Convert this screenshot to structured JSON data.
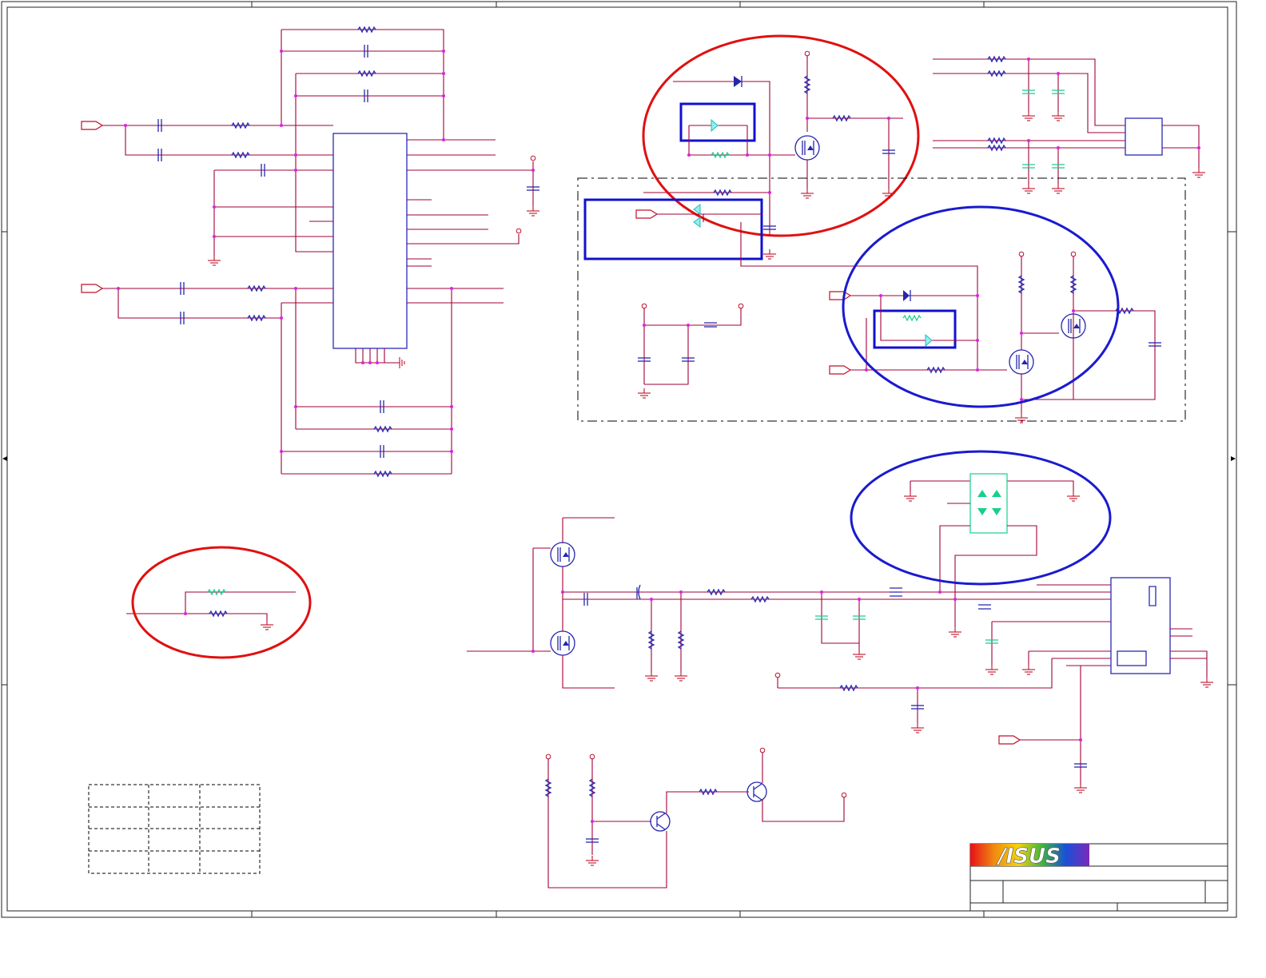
{
  "title_block": {
    "logo_text": "/ISUS",
    "logo_colors": [
      "#e8101a",
      "#f08a10",
      "#f5d20a",
      "#3fb83a",
      "#1a50d8",
      "#7a2ab8"
    ]
  },
  "highlight_colors": {
    "red_circle": "#e01010",
    "blue_circle": "#1a1ad0",
    "wire": "#a2003a",
    "component": "#2626b0"
  },
  "icons": [
    "resistor-icon",
    "capacitor-icon",
    "diode-icon",
    "mosfet-icon",
    "bjt-icon",
    "ground-icon",
    "vcc-pin-icon",
    "off-page-port-icon",
    "ic-chip-icon",
    "connector-jack-icon",
    "bead-icon"
  ]
}
